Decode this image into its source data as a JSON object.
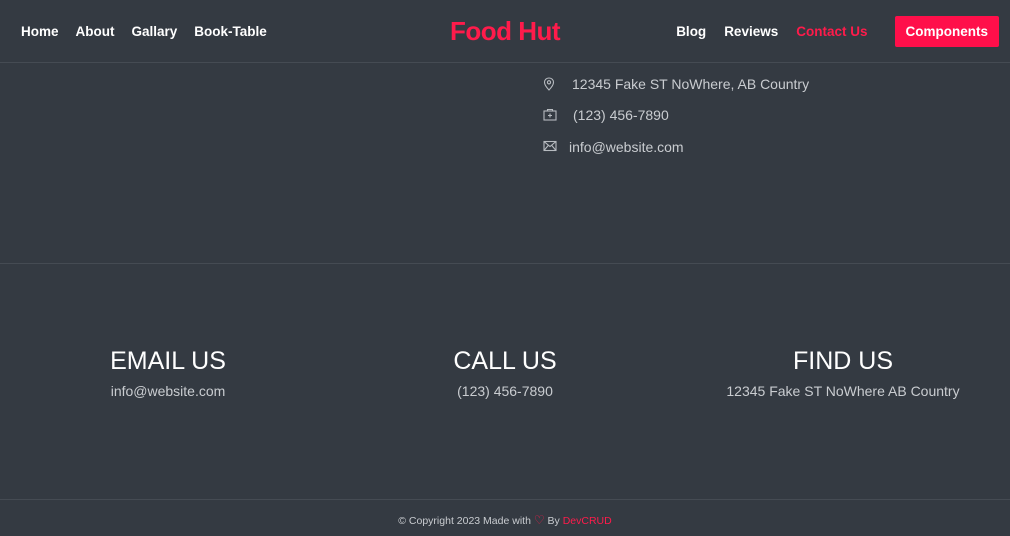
{
  "nav": {
    "left_links": [
      "Home",
      "About",
      "Gallary",
      "Book-Table"
    ],
    "brand": "Food Hut",
    "right_links": [
      "Blog",
      "Reviews",
      "Contact Us"
    ],
    "active_link": "Contact Us",
    "components_button": "Components"
  },
  "contact_info": {
    "address": "12345 Fake ST NoWhere, AB Country",
    "phone": "(123) 456-7890",
    "email": "info@website.com"
  },
  "features": [
    {
      "title": "EMAIL US",
      "value": "info@website.com"
    },
    {
      "title": "CALL US",
      "value": "(123) 456-7890"
    },
    {
      "title": "FIND US",
      "value": "12345 Fake ST NoWhere AB Country"
    }
  ],
  "footer": {
    "prefix": "© Copyright 2023 Made with",
    "heart": "♡",
    "by": "By",
    "author": "DevCRUD"
  },
  "colors": {
    "background": "#343a42",
    "accent": "#ff1b4b",
    "text_muted": "#c9ccd0"
  },
  "icons": {
    "address": "map-pin-icon",
    "phone": "phone-icon",
    "email": "envelope-icon"
  }
}
